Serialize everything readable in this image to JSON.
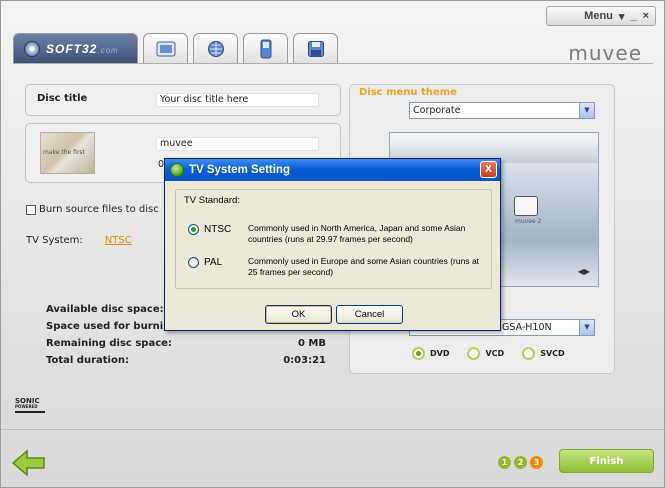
{
  "menu": {
    "label": "Menu",
    "dropdown": "▾",
    "minimize": "_",
    "close": "×"
  },
  "tabs": {
    "brand": "SOFT32",
    "brand_suffix": ".com"
  },
  "logo": "muvee",
  "disc_title": {
    "label": "Disc title",
    "value": "Your disc title here"
  },
  "thumbnail": {
    "caption": "muvee",
    "caption_partial": "0",
    "thumb_text": "make the first"
  },
  "burn_source": {
    "label": "Burn source files to disc",
    "checked": false
  },
  "tv_system": {
    "label": "TV System:",
    "value": "NTSC"
  },
  "stats": [
    {
      "label": "Available disc space:",
      "value": ""
    },
    {
      "label": "Space used for burnin",
      "value": ""
    },
    {
      "label": "Remaining disc space:",
      "value": "0 MB"
    },
    {
      "label": "Total duration:",
      "value": "0:03:21"
    }
  ],
  "sonic": {
    "line1": "SONIC",
    "line2": "POWERED"
  },
  "theme": {
    "label": "Disc menu theme",
    "selected": "Corporate",
    "preview_caption": "muvee 2",
    "preview_nav": "◀▶"
  },
  "drive": {
    "selected": "GSA-H10N"
  },
  "disc_types": [
    {
      "label": "DVD",
      "selected": true
    },
    {
      "label": "VCD",
      "selected": false
    },
    {
      "label": "SVCD",
      "selected": false
    }
  ],
  "steps": [
    "1",
    "2",
    "3"
  ],
  "finish_label": "Finish",
  "dialog": {
    "title": "TV System Setting",
    "close": "X",
    "heading": "TV Standard:",
    "options": [
      {
        "label": "NTSC",
        "desc": "Commonly used in North America, Japan and some Asian countries (runs at 29.97 frames per second)",
        "selected": true
      },
      {
        "label": "PAL",
        "desc": "Commonly used in Europe and some Asian countries (runs at 25 frames per second)",
        "selected": false
      }
    ],
    "ok": "OK",
    "cancel": "Cancel"
  },
  "colors": {
    "accent_orange": "#f0a020",
    "accent_green": "#8fbf2f",
    "xp_title_blue": "#0a5fd8"
  }
}
